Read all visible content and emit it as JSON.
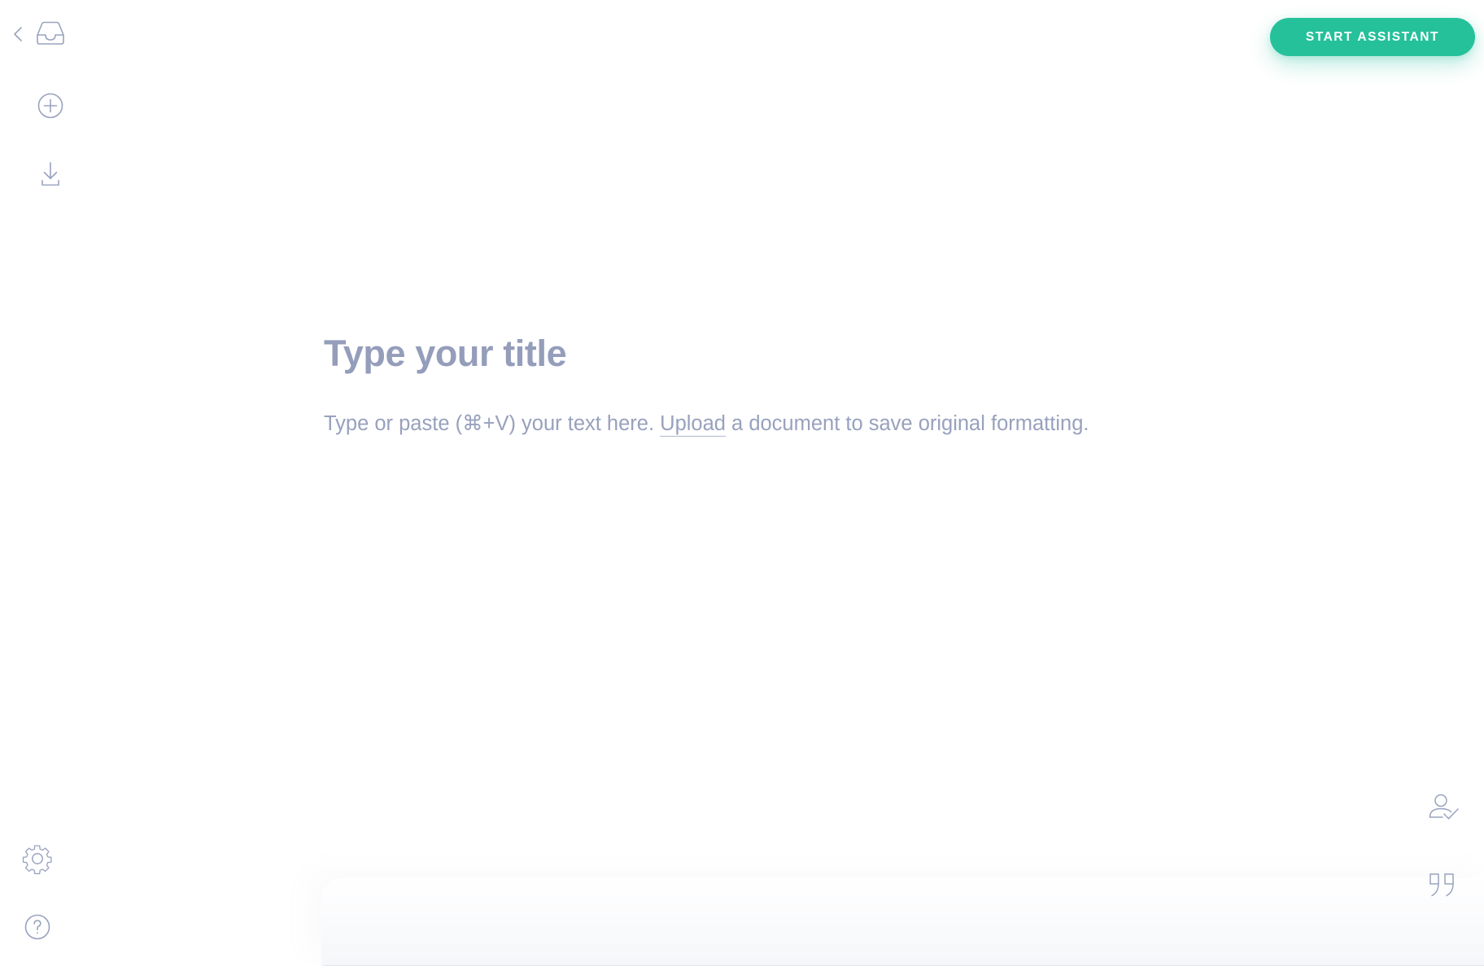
{
  "app": {
    "background_color": "#ffffff",
    "accent_color": "#25c19a",
    "muted_text_color": "#98a1bd",
    "icon_color": "#9aa3bf"
  },
  "toolbar": {
    "assistant_button_label": "START ASSISTANT"
  },
  "left_rail": {
    "items": [
      {
        "name": "back",
        "icon": "chevron-left-icon",
        "label": ""
      },
      {
        "name": "inbox",
        "icon": "inbox-icon",
        "label": ""
      },
      {
        "name": "new-document",
        "icon": "plus-circle-icon",
        "label": ""
      },
      {
        "name": "import-document",
        "icon": "download-icon",
        "label": ""
      },
      {
        "name": "settings",
        "icon": "gear-icon",
        "label": ""
      },
      {
        "name": "help",
        "icon": "question-circle-icon",
        "label": ""
      }
    ]
  },
  "right_rail": {
    "items": [
      {
        "name": "reviewer",
        "icon": "person-check-icon",
        "label": ""
      },
      {
        "name": "quotes",
        "icon": "quotation-mark-icon",
        "label": ""
      }
    ],
    "quote_glyph": "”"
  },
  "document": {
    "title_placeholder": "Type your title",
    "body_placeholder_before": "Type or paste (⌘+V) your text here. ",
    "body_upload_link": "Upload",
    "body_placeholder_after": " a document to save original formatting."
  }
}
